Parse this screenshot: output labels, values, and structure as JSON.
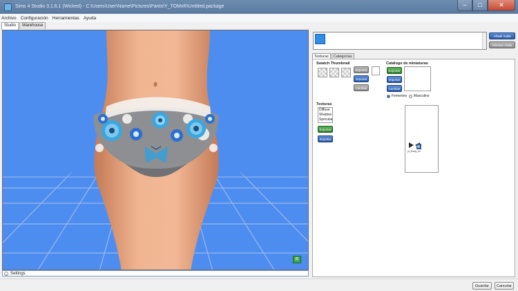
{
  "window": {
    "title": "Sims 4 Studio 3.1.6.1 (Wicked) - C:\\Users\\User\\Name\\Pictures\\Pants\\Y_TOMxR\\Untitled.package"
  },
  "menu": [
    "Archivo",
    "Configuración",
    "Herramientas",
    "Ayuda"
  ],
  "tabs": [
    "Studio",
    "Warehouse"
  ],
  "viewport": {
    "settings_label": "Settings",
    "r_badge": "R"
  },
  "right": {
    "add_mesh": "Añadir malla",
    "remove_mesh": "Eliminar malla",
    "inner_tabs": [
      "Texturas",
      "Categorías"
    ],
    "swatch_header": "Swatch Thumbnail",
    "catalog_header": "Catálogo de miniaturas",
    "export": "Exportar",
    "import": "Importar",
    "change": "Cambiar",
    "female": "Femenino",
    "male": "Masculino",
    "textures_header": "Texturas",
    "texture_items": [
      "Diffuse",
      "Shadow",
      "Specular"
    ],
    "thumb_label": "yf_tbody_ne"
  },
  "footer": {
    "save": "Guardar",
    "cancel": "Cancelar"
  },
  "colors": {
    "viewport_bg": "#4e8df0",
    "accent_blue": "#2f8ee8"
  }
}
